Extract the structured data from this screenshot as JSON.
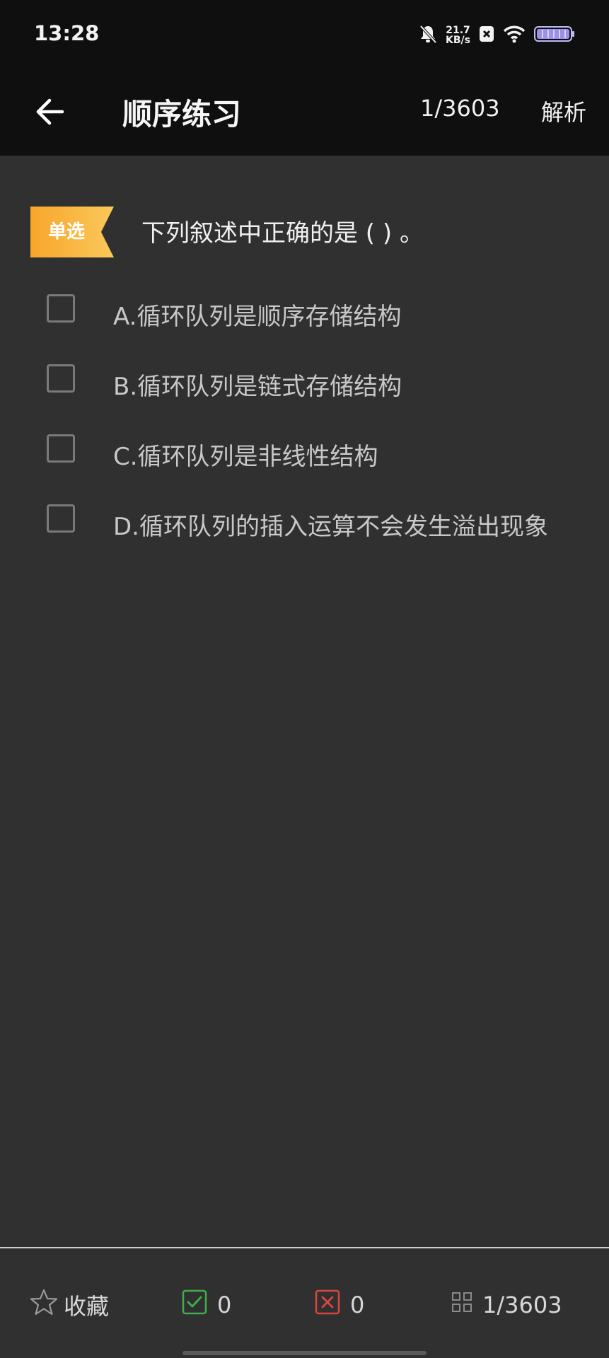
{
  "status_bar": {
    "time": "13:28",
    "net_speed_value": "21.7",
    "net_speed_unit": "KB/s",
    "icons": [
      "bell-off-icon",
      "close-box-icon",
      "wifi-icon",
      "battery-icon"
    ]
  },
  "app_bar": {
    "back_icon": "back-arrow-icon",
    "title": "顺序练习",
    "progress": "1/3603",
    "analysis_label": "解析"
  },
  "question": {
    "type_badge": "单选",
    "stem": "下列叙述中正确的是 ( ) 。",
    "options": [
      {
        "text": "A.循环队列是顺序存储结构"
      },
      {
        "text": "B.循环队列是链式存储结构"
      },
      {
        "text": "C.循环队列是非线性结构"
      },
      {
        "text": "D.循环队列的插入运算不会发生溢出现象"
      }
    ]
  },
  "bottom_bar": {
    "favorite_label": "收藏",
    "correct_count": "0",
    "wrong_count": "0",
    "progress": "1/3603"
  },
  "colors": {
    "background": "#303030",
    "bar": "#0f0f0f",
    "badge": "#f5b335",
    "correct": "#3fae4a",
    "wrong": "#d9463f"
  }
}
